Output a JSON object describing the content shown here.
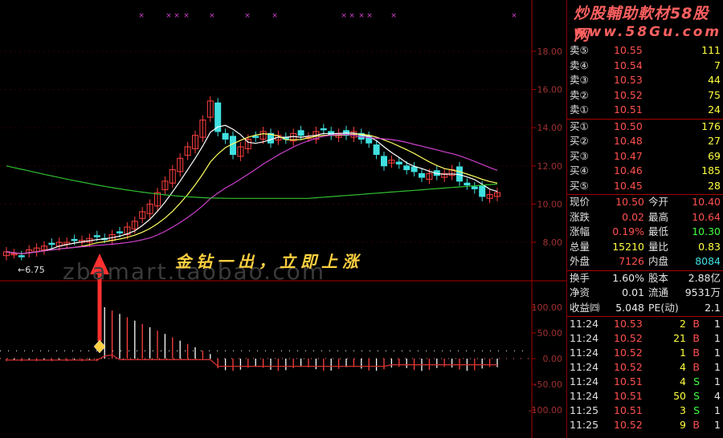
{
  "brand": {
    "line1": "炒股輔助軟材58股网",
    "line2": "www.58Gu.com"
  },
  "caption": "金钻一出，立即上涨",
  "watermark": "zbamart.taobao.com",
  "min_price_marker": "←6.75",
  "price_axis": [
    "18.00",
    "16.00",
    "14.00",
    "12.00",
    "10.00",
    "8.00"
  ],
  "osc_axis": [
    "100.00",
    "50.00",
    "0.00",
    "-50.00",
    "-100.00"
  ],
  "asks": [
    {
      "label": "卖⑤",
      "price": "10.55",
      "vol": "111"
    },
    {
      "label": "卖④",
      "price": "10.54",
      "vol": "7"
    },
    {
      "label": "卖③",
      "price": "10.53",
      "vol": "44"
    },
    {
      "label": "卖②",
      "price": "10.52",
      "vol": "75"
    },
    {
      "label": "卖①",
      "price": "10.51",
      "vol": "24"
    }
  ],
  "bids": [
    {
      "label": "买①",
      "price": "10.50",
      "vol": "176"
    },
    {
      "label": "买②",
      "price": "10.48",
      "vol": "27"
    },
    {
      "label": "买③",
      "price": "10.47",
      "vol": "69"
    },
    {
      "label": "买④",
      "price": "10.46",
      "vol": "185"
    },
    {
      "label": "买⑤",
      "price": "10.45",
      "vol": "28"
    }
  ],
  "quote": [
    {
      "l1": "现价",
      "v1": "10.50",
      "l2": "今开",
      "v2": "10.40"
    },
    {
      "l1": "涨跌",
      "v1": "0.02",
      "l2": "最高",
      "v2": "10.64"
    },
    {
      "l1": "涨幅",
      "v1": "0.19%",
      "l2": "最低",
      "v2": "10.30"
    },
    {
      "l1": "总量",
      "v1": "15210",
      "l2": "量比",
      "v2": "0.83"
    },
    {
      "l1": "外盘",
      "v1": "7126",
      "l2": "内盘",
      "v2": "8084"
    }
  ],
  "stats": [
    {
      "l1": "换手",
      "v1": "1.60%",
      "l2": "股本",
      "v2": "2.88亿"
    },
    {
      "l1": "净资",
      "v1": "0.01",
      "l2": "流通",
      "v2": "9531万"
    },
    {
      "l1": "收益㈣",
      "v1": "5.048",
      "l2": "PE(动)",
      "v2": "2.1"
    }
  ],
  "ticks": [
    {
      "time": "11:24",
      "price": "10.53",
      "vol": "2",
      "side": "B",
      "n": "1"
    },
    {
      "time": "11:24",
      "price": "10.52",
      "vol": "21",
      "side": "B",
      "n": "1"
    },
    {
      "time": "11:24",
      "price": "10.52",
      "vol": "1",
      "side": "B",
      "n": "1"
    },
    {
      "time": "11:24",
      "price": "10.52",
      "vol": "4",
      "side": "B",
      "n": "1"
    },
    {
      "time": "11:24",
      "price": "10.51",
      "vol": "4",
      "side": "S",
      "n": "1"
    },
    {
      "time": "11:24",
      "price": "10.51",
      "vol": "50",
      "side": "S",
      "n": "4"
    },
    {
      "time": "11:25",
      "price": "10.51",
      "vol": "3",
      "side": "S",
      "n": "1"
    },
    {
      "time": "11:25",
      "price": "10.52",
      "vol": "9",
      "side": "B",
      "n": "1"
    }
  ],
  "colors": {
    "up": "#ff4040",
    "down": "#40e0e0",
    "ma5": "#ffffff",
    "ma10": "#ffff60",
    "ma20": "#d040d0",
    "ma60": "#30c030",
    "osc_up": "#ff4040",
    "osc_down": "#ffffff",
    "signal": "#ff8080"
  }
}
